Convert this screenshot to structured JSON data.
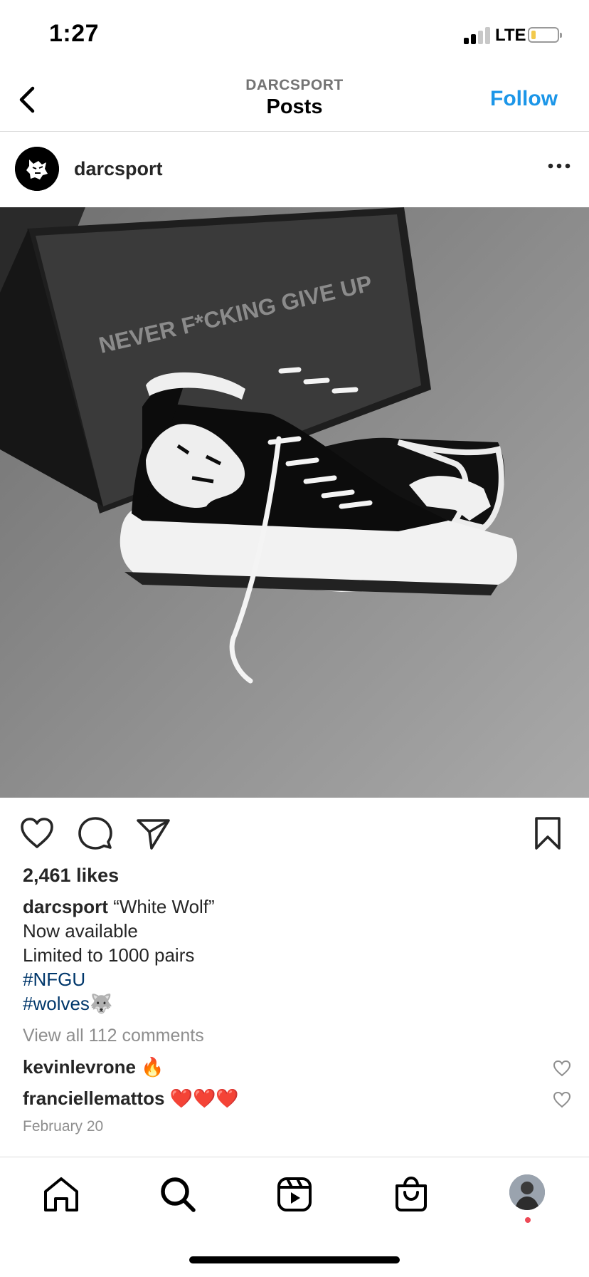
{
  "status_bar": {
    "time": "1:27",
    "network": "LTE"
  },
  "header": {
    "account": "DARCSPORT",
    "title": "Posts",
    "follow_label": "Follow"
  },
  "post": {
    "username": "darcsport",
    "image_box_text": "NEVER F*CKING GIVE UP",
    "likes": "2,461 likes",
    "caption": {
      "user": "darcsport",
      "lines": [
        "“White Wolf”",
        "Now available",
        "Limited to 1000 pairs"
      ],
      "hashtags": [
        "#NFGU",
        "#wolves"
      ],
      "emoji": "🐺"
    },
    "view_comments": "View all 112 comments",
    "comments": [
      {
        "user": "kevinlevrone",
        "text": "🔥"
      },
      {
        "user": "franciellemattos",
        "text": "❤️❤️❤️"
      }
    ],
    "date": "February 20"
  },
  "colors": {
    "link": "#1c96e8",
    "hashtag": "#00376b",
    "secondary": "#8e8e8e",
    "notification": "#ed4956"
  }
}
